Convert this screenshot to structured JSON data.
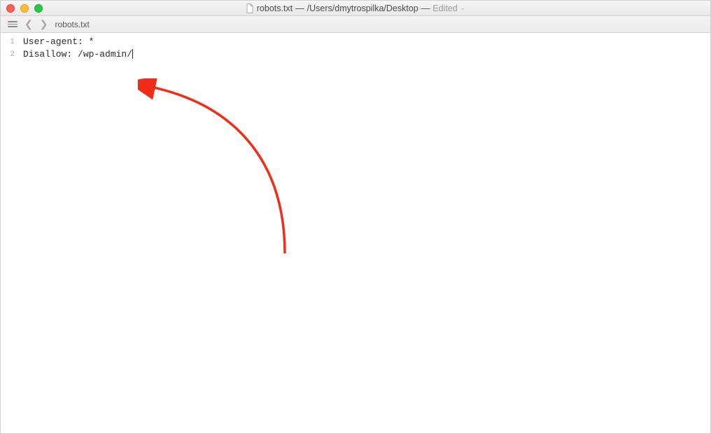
{
  "titlebar": {
    "filename": "robots.txt",
    "path": "/Users/dmytrospilka/Desktop",
    "edited_label": "Edited"
  },
  "toolbar": {
    "filename": "robots.txt"
  },
  "editor": {
    "lines": [
      {
        "num": "1",
        "text": "User-agent: *"
      },
      {
        "num": "2",
        "text": "Disallow: /wp-admin/"
      }
    ]
  }
}
